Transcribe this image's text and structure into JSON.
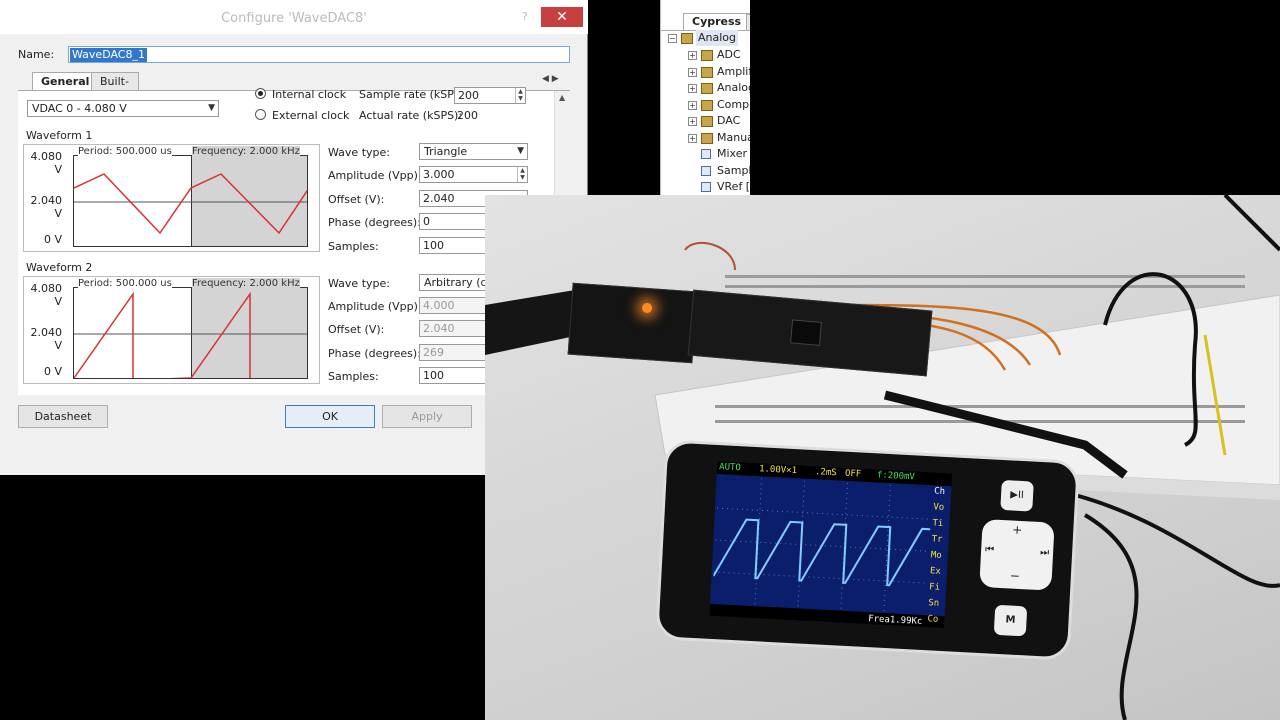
{
  "dialog": {
    "title": "Configure 'WaveDAC8'",
    "help_glyph": "?",
    "close_glyph": "✕",
    "name_label": "Name:",
    "name_value": "WaveDAC8_1",
    "tabs": [
      {
        "label": "General"
      },
      {
        "label": "Built-in"
      }
    ],
    "tab_scroll_glyphs": "◀ ▶",
    "range_select": "VDAC 0 - 4.080 V",
    "clock": {
      "internal_label": "Internal clock",
      "external_label": "External clock",
      "selected": "internal",
      "sample_rate_label": "Sample rate (kSPS):",
      "sample_rate_value": "200",
      "actual_rate_label": "Actual rate (kSPS):",
      "actual_rate_value": "200"
    },
    "waveform1": {
      "title": "Waveform 1",
      "period_label": "Period: 500.000 us",
      "frequency_label": "Frequency: 2.000 kHz",
      "y_labels": [
        "4.080 V",
        "2.040 V",
        "0 V"
      ],
      "wave_type_label": "Wave type:",
      "wave_type_value": "Triangle",
      "amplitude_label": "Amplitude (Vpp):",
      "amplitude_value": "3.000",
      "offset_label": "Offset (V):",
      "offset_value": "2.040",
      "phase_label": "Phase (degrees):",
      "phase_value": "0",
      "samples_label": "Samples:",
      "samples_value": "100"
    },
    "waveform2": {
      "title": "Waveform 2",
      "period_label": "Period: 500.000 us",
      "frequency_label": "Frequency: 2.000 kHz",
      "y_labels": [
        "4.080 V",
        "2.040 V",
        "0 V"
      ],
      "wave_type_label": "Wave type:",
      "wave_type_value": "Arbitrary (draw",
      "amplitude_label": "Amplitude (Vpp):",
      "amplitude_value": "4.000",
      "offset_label": "Offset (V):",
      "offset_value": "2.040",
      "phase_label": "Phase (degrees):",
      "phase_value": "269",
      "samples_label": "Samples:",
      "samples_value": "100"
    },
    "buttons": {
      "datasheet": "Datasheet",
      "ok": "OK",
      "apply": "Apply"
    },
    "colors": {
      "waveform": "#d93030",
      "selection": "#3377cc",
      "close": "#c74040"
    }
  },
  "catalog": {
    "tab_active": "Cypress",
    "tab_other": "O",
    "root": "Analog",
    "folders": [
      "ADC",
      "Amplif",
      "Analog",
      "Compa",
      "DAC",
      "Manua"
    ],
    "components": [
      "Mixer [",
      "Sample",
      "VRef [v"
    ]
  },
  "oscilloscope": {
    "mode": "AUTO",
    "voltage_div": "1.00V×1",
    "time_div": ".2mS",
    "off": "OFF",
    "trigger": "f:200mV",
    "frequency": "Frea1.99Kc",
    "side_menu": [
      "Ch",
      "Vo",
      "Ti",
      "Tr",
      "Mo",
      "Ex",
      "Fi",
      "Sn",
      "Co"
    ],
    "buttons": {
      "play_pause": "▶II",
      "plus": "+",
      "minus": "−",
      "prev": "⏮",
      "next": "⏭",
      "menu": "M"
    },
    "colors": {
      "screen": "#0b1e6b",
      "trace": "#7fd0ff",
      "status_yellow": "#f0e040",
      "status_green": "#40e060"
    }
  }
}
